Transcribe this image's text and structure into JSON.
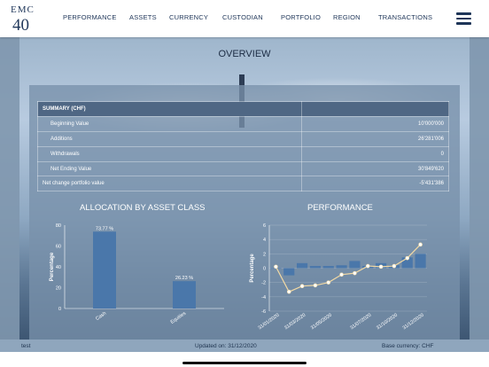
{
  "logo": {
    "brand": "EMC",
    "anniversary": "40"
  },
  "nav": {
    "items": [
      "PERFORMANCE",
      "ASSETS",
      "CURRENCY",
      "CUSTODIAN",
      "PORTFOLIO",
      "REGION",
      "TRANSACTIONS"
    ]
  },
  "page_title": "OVERVIEW",
  "summary": {
    "header": "SUMMARY (CHF)",
    "rows": [
      {
        "label": "Beginning Value",
        "value": "10'000'000"
      },
      {
        "label": "Additions",
        "value": "26'281'006"
      },
      {
        "label": "Withdrawals",
        "value": "0"
      },
      {
        "label": "Net Ending Value",
        "value": "30'849'620"
      },
      {
        "label": "Net change portfolio value",
        "value": "-5'431'386"
      }
    ]
  },
  "chart_data": [
    {
      "type": "bar",
      "title": "ALLOCATION BY ASSET CLASS",
      "ylabel": "Percentage",
      "categories": [
        "Cash",
        "Equities"
      ],
      "values": [
        73.77,
        26.23
      ],
      "data_labels": [
        "73.77 %",
        "26.23 %"
      ],
      "ylim": [
        0,
        80
      ],
      "yticks": [
        "0",
        "20",
        "40",
        "60",
        "80"
      ],
      "color": "#4a77aa"
    },
    {
      "type": "line",
      "title": "PERFORMANCE",
      "ylabel": "Percentage",
      "ylim": [
        -6,
        6
      ],
      "yticks": [
        "-6",
        "-4",
        "-2",
        "0",
        "2",
        "4",
        "6"
      ],
      "xticks": [
        "31/01/2020",
        "31/03/2020",
        "31/05/2020",
        "31/07/2020",
        "31/10/2020",
        "31/12/2020"
      ],
      "bars": [
        0.0,
        -1.0,
        0.7,
        0.3,
        0.3,
        0.4,
        1.0,
        0.3,
        0.7,
        0.4,
        1.5,
        2.0
      ],
      "line": [
        0.2,
        -3.3,
        -2.5,
        -2.4,
        -2.0,
        -0.9,
        -0.7,
        0.3,
        0.2,
        0.3,
        1.4,
        3.3
      ],
      "bar_color": "#4a77aa",
      "line_color": "#f2d9a4"
    }
  ],
  "footer": {
    "left": "test",
    "center": "Updated on: 31/12/2020",
    "right": "Base currency: CHF"
  }
}
